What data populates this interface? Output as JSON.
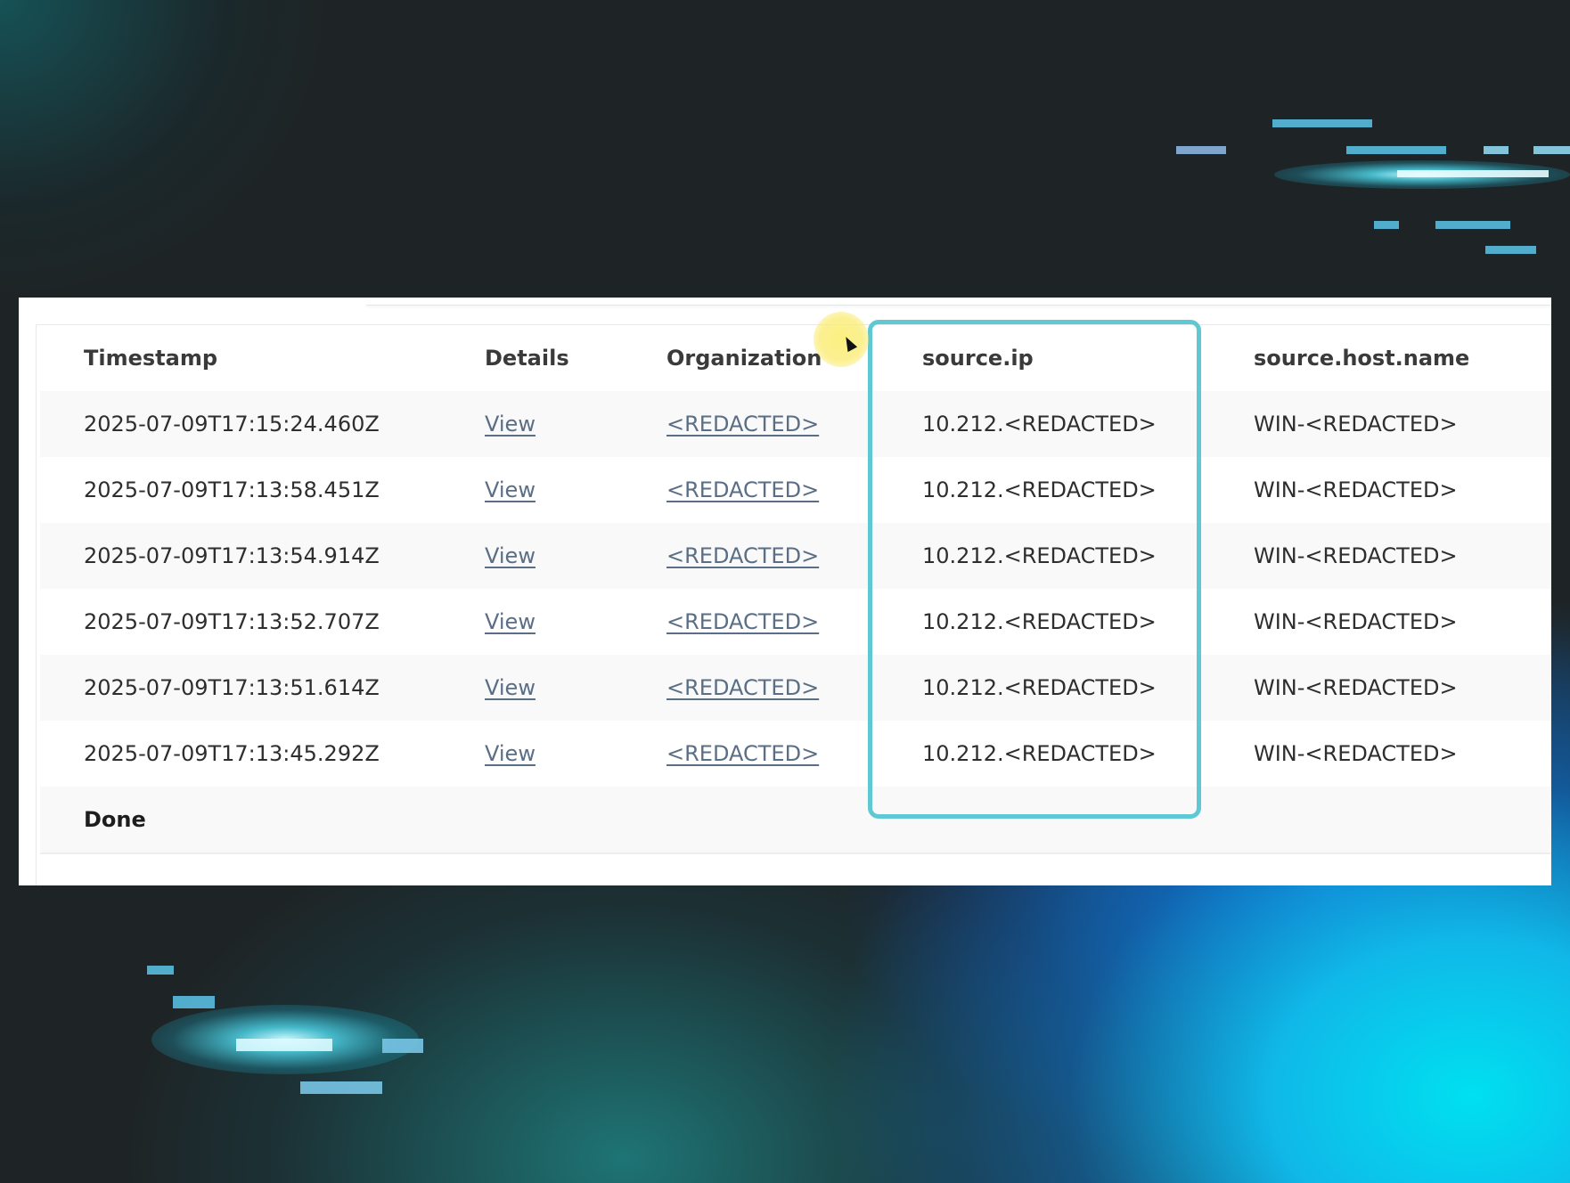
{
  "table": {
    "headers": {
      "timestamp": "Timestamp",
      "details": "Details",
      "organization": "Organization",
      "source_ip": "source.ip",
      "source_host_name": "source.host.name"
    },
    "rows": [
      {
        "timestamp": "2025-07-09T17:15:24.460Z",
        "details": "View",
        "organization": "<REDACTED>",
        "source_ip": "10.212.<REDACTED>",
        "source_host_name": "WIN-<REDACTED>"
      },
      {
        "timestamp": "2025-07-09T17:13:58.451Z",
        "details": "View",
        "organization": "<REDACTED>",
        "source_ip": "10.212.<REDACTED>",
        "source_host_name": "WIN-<REDACTED>"
      },
      {
        "timestamp": "2025-07-09T17:13:54.914Z",
        "details": "View",
        "organization": "<REDACTED>",
        "source_ip": "10.212.<REDACTED>",
        "source_host_name": "WIN-<REDACTED>"
      },
      {
        "timestamp": "2025-07-09T17:13:52.707Z",
        "details": "View",
        "organization": "<REDACTED>",
        "source_ip": "10.212.<REDACTED>",
        "source_host_name": "WIN-<REDACTED>"
      },
      {
        "timestamp": "2025-07-09T17:13:51.614Z",
        "details": "View",
        "organization": "<REDACTED>",
        "source_ip": "10.212.<REDACTED>",
        "source_host_name": "WIN-<REDACTED>"
      },
      {
        "timestamp": "2025-07-09T17:13:45.292Z",
        "details": "View",
        "organization": "<REDACTED>",
        "source_ip": "10.212.<REDACTED>",
        "source_host_name": "WIN-<REDACTED>"
      }
    ],
    "status": "Done"
  },
  "colors": {
    "highlight_border": "#5ec9d2",
    "link": "#5a6e86",
    "cursor_halo": "#f7ec7a"
  },
  "icons": {
    "cursor": "mouse-pointer-icon"
  }
}
